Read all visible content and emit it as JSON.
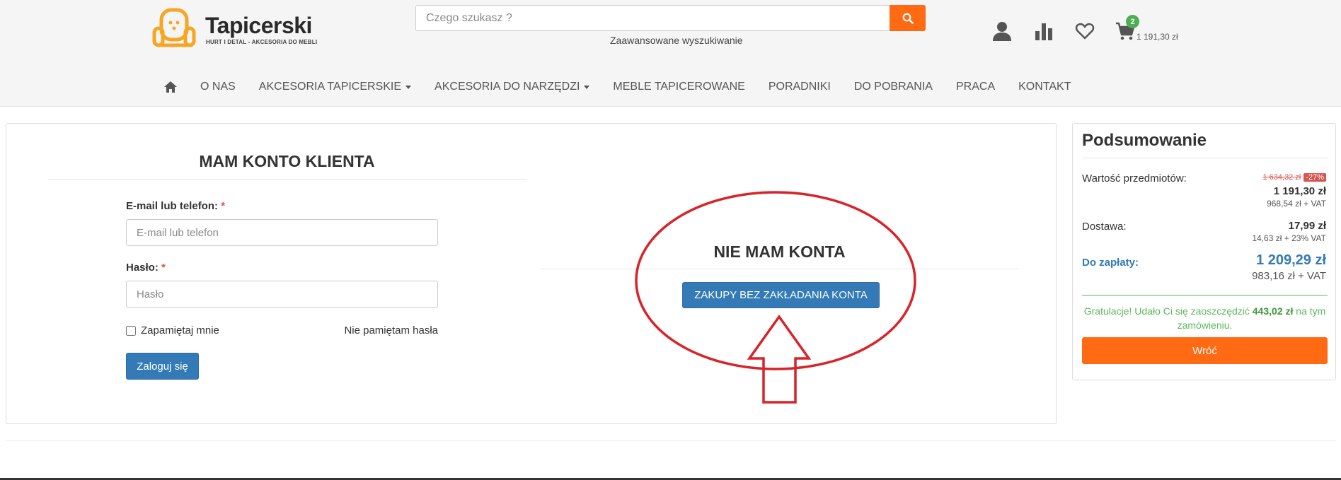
{
  "header": {
    "logo_name": "Tapicerski",
    "logo_tagline": "HURT I DETAL - AKCESORIA DO MEBLI",
    "search_placeholder": "Czego szukasz ?",
    "advanced_search": "Zaawansowane wyszukiwanie",
    "cart_count": "2",
    "cart_total": "1 191,30 zł",
    "icons": [
      "user-icon",
      "chart-icon",
      "heart-icon",
      "cart-icon",
      "search-icon"
    ]
  },
  "nav": {
    "home_icon": "home-icon",
    "items": [
      "O NAS",
      "AKCESORIA TAPICERSKIE",
      "AKCESORIA DO NARZĘDZI",
      "MEBLE TAPICEROWANE",
      "PORADNIKI",
      "DO POBRANIA",
      "PRACA",
      "KONTAKT"
    ]
  },
  "login": {
    "title": "MAM KONTO KLIENTA",
    "email_label": "E-mail lub telefon:",
    "email_placeholder": "E-mail lub telefon",
    "password_label": "Hasło:",
    "password_placeholder": "Hasło",
    "required_mark": "*",
    "remember": "Zapamiętaj mnie",
    "forgot": "Nie pamiętam hasła",
    "submit": "Zaloguj się"
  },
  "guest": {
    "title": "NIE MAM KONTA",
    "button": "ZAKUPY BEZ ZAKŁADANIA KONTA"
  },
  "summary": {
    "title": "Podsumowanie",
    "items_label": "Wartość przedmiotów:",
    "items_old_price": "1 634,32 zł",
    "items_discount": "-27%",
    "items_price": "1 191,30 zł",
    "items_net": "968,54 zł + VAT",
    "delivery_label": "Dostawa:",
    "delivery_price": "17,99 zł",
    "delivery_net": "14,63 zł + 23% VAT",
    "pay_label": "Do zapłaty:",
    "pay_price": "1 209,29 zł",
    "pay_net": "983,16 zł + VAT",
    "congrats_prefix": "Gratulacje! Udało Ci się zaoszczędzić",
    "congrats_amount": "443,02 zł",
    "congrats_suffix": "na tym zamówieniu.",
    "back_button": "Wróć"
  },
  "colors": {
    "accent_orange": "#ff6a13",
    "primary_blue": "#337ab7",
    "annotation_red": "#d8232a",
    "success_green": "#5cb85c",
    "discount_red": "#d9534f"
  }
}
